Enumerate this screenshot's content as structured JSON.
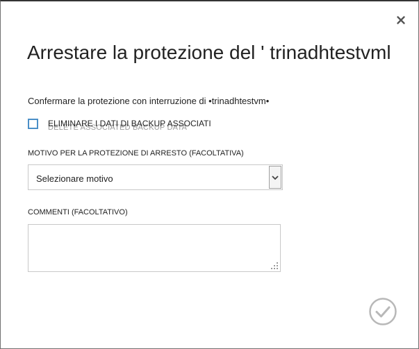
{
  "dialog": {
    "title": "Arrestare la protezione del ' trinadhtestvml",
    "confirm_text": "Confermare la protezione con interruzione di •trinadhtestvm•",
    "delete_backup": {
      "label": "ELIMINARE I DATI DI BACKUP ASSOCIATI",
      "ghost_text": "DELETE ASSOCIATED BACKUP DATA",
      "checked": false
    },
    "reason": {
      "label": "MOTIVO PER LA PROTEZIONE DI ARRESTO (FACOLTATIVA)",
      "selected": "Selezionare motivo"
    },
    "comments": {
      "label": "COMMENTI (FACOLTATIVO)",
      "value": ""
    },
    "icons": {
      "close": "close-icon",
      "dropdown": "chevron-down-icon",
      "confirm": "checkmark-circle-icon",
      "resize": "resize-grip-icon"
    },
    "colors": {
      "checkbox_border": "#4a8fc7",
      "confirm_icon": "#b8b8b8"
    }
  }
}
